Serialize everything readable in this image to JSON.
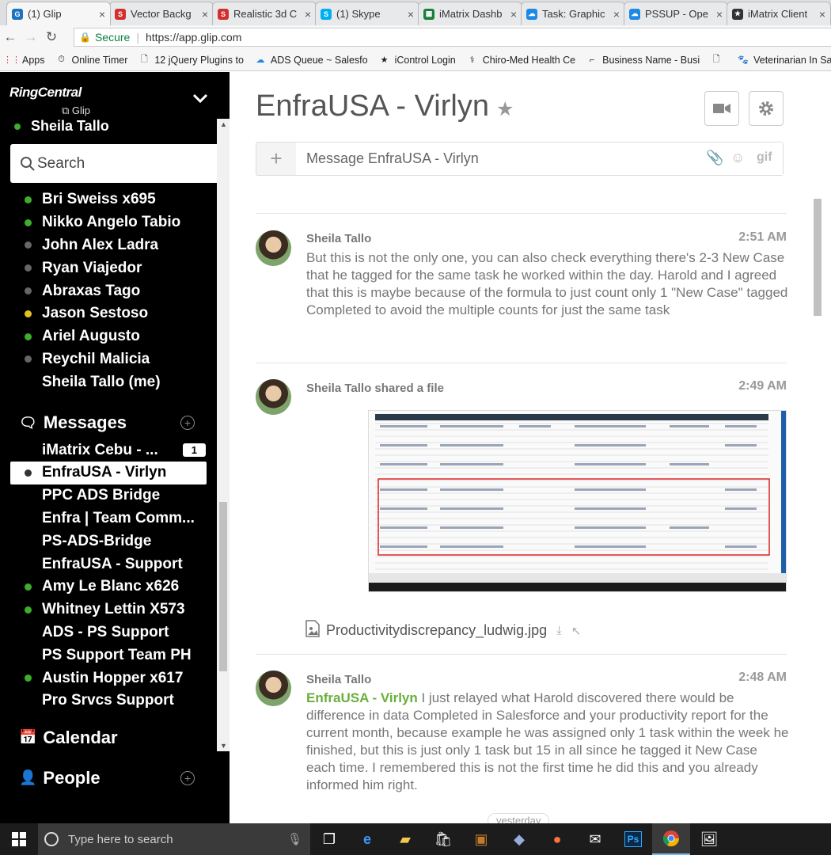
{
  "browser": {
    "tabs": [
      {
        "title": "(1) Glip",
        "color": "#1e73be",
        "glyph": "G"
      },
      {
        "title": "Vector Backg",
        "color": "#d32f2f",
        "glyph": "S"
      },
      {
        "title": "Realistic 3d C",
        "color": "#d32f2f",
        "glyph": "S"
      },
      {
        "title": "(1) Skype",
        "color": "#00aff0",
        "glyph": "S"
      },
      {
        "title": "iMatrix Dashb",
        "color": "#188038",
        "glyph": "▦"
      },
      {
        "title": "Task: Graphic",
        "color": "#1e88e5",
        "glyph": "☁"
      },
      {
        "title": "PSSUP - Ope",
        "color": "#1e88e5",
        "glyph": "☁"
      },
      {
        "title": "iMatrix Client",
        "color": "#333333",
        "glyph": "★"
      }
    ],
    "address": {
      "secure_label": "Secure",
      "url": "https://app.glip.com"
    },
    "bookmarks": [
      {
        "label": "Apps",
        "icon": "apps-icon"
      },
      {
        "label": "Online Timer",
        "icon": "timer-icon"
      },
      {
        "label": "12 jQuery Plugins to",
        "icon": "page-icon"
      },
      {
        "label": "ADS Queue ~ Salesfo",
        "icon": "cloud-icon"
      },
      {
        "label": "iControl Login",
        "icon": "star-icon"
      },
      {
        "label": "Chiro-Med Health Ce",
        "icon": "logo-icon"
      },
      {
        "label": "Business Name - Busi",
        "icon": "bracket-icon"
      },
      {
        "label": "",
        "icon": "page-icon"
      },
      {
        "label": "Veterinarian In San D",
        "icon": "paw-icon"
      }
    ]
  },
  "sidebar": {
    "brand": "RingCentral",
    "brand_sub": "Glip",
    "user": "Sheila Tallo",
    "search_placeholder": "Search",
    "people": [
      {
        "name": "Bri Sweiss x695",
        "status": "green"
      },
      {
        "name": "Nikko Angelo Tabio",
        "status": "green"
      },
      {
        "name": "John Alex Ladra",
        "status": "gray"
      },
      {
        "name": "Ryan Viajedor",
        "status": "gray"
      },
      {
        "name": "Abraxas Tago",
        "status": "gray"
      },
      {
        "name": "Jason Sestoso",
        "status": "yellow"
      },
      {
        "name": "Ariel Augusto",
        "status": "green"
      },
      {
        "name": "Reychil Malicia",
        "status": "gray"
      },
      {
        "name": "Sheila Tallo (me)",
        "status": "none"
      }
    ],
    "messages_title": "Messages",
    "conversations": [
      {
        "name": "iMatrix Cebu - ...",
        "status": "none",
        "badge": "1"
      },
      {
        "name": "EnfraUSA - Virlyn",
        "status": "dark",
        "selected": true
      },
      {
        "name": "PPC ADS Bridge",
        "status": "none"
      },
      {
        "name": "Enfra | Team Comm...",
        "status": "none"
      },
      {
        "name": "PS-ADS-Bridge",
        "status": "none"
      },
      {
        "name": "EnfraUSA - Support",
        "status": "none"
      },
      {
        "name": "Amy Le Blanc x626",
        "status": "green"
      },
      {
        "name": "Whitney Lettin X573",
        "status": "green"
      },
      {
        "name": "ADS - PS Support",
        "status": "none"
      },
      {
        "name": "PS Support Team PH",
        "status": "none"
      },
      {
        "name": "Austin Hopper x617",
        "status": "green"
      },
      {
        "name": "Pro Srvcs Support",
        "status": "none"
      }
    ],
    "calendar_title": "Calendar",
    "people_title": "People"
  },
  "main": {
    "title": "EnfraUSA - Virlyn",
    "composer_placeholder": "Message EnfraUSA - Virlyn",
    "gif_label": "gif",
    "messages": [
      {
        "sender": "Sheila Tallo",
        "time": "2:51 AM",
        "text": "But this is not the only one, you can also check everything there's 2-3 New Case that he tagged for the same task he worked within the day. Harold and I agreed that this is maybe because of the formula to just count only 1 \"New Case\" tagged Completed to avoid the multiple counts for just the same task"
      },
      {
        "sender": "Sheila Tallo shared a file",
        "time": "2:49 AM",
        "file_name": "Productivitydiscrepancy_ludwig.jpg"
      },
      {
        "sender": "Sheila Tallo",
        "time": "2:48 AM",
        "mention": "EnfraUSA - Virlyn",
        "text": " I just relayed what Harold discovered there would be difference in data Completed in Salesforce and your productivity report for the current month, because example he was assigned only 1 task within the week he finished, but this is just only 1 task but 15 in all since he tagged it New Case each time. I remembered this is not the first time he did this and you already informed him right."
      }
    ],
    "day_separator": "yesterday"
  },
  "taskbar": {
    "search_placeholder": "Type here to search"
  }
}
